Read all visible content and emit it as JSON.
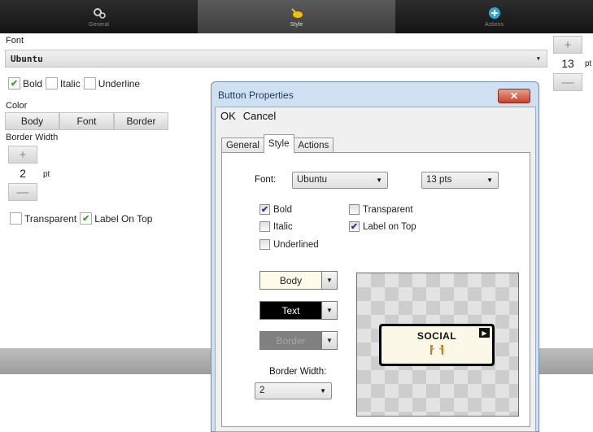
{
  "top_tabs": [
    {
      "label": "General",
      "icon": "gear-icon"
    },
    {
      "label": "Style",
      "icon": "style-icon"
    },
    {
      "label": "Actions",
      "icon": "plus-circle-icon"
    }
  ],
  "bg": {
    "font_label": "Font",
    "font_value": "Ubuntu",
    "font_size": "13",
    "font_size_unit": "pt",
    "bold": "Bold",
    "italic": "Italic",
    "underline": "Underline",
    "color_label": "Color",
    "color_buttons": [
      "Body",
      "Font",
      "Border"
    ],
    "border_width_label": "Border Width",
    "border_width_value": "2",
    "border_width_unit": "pt",
    "transparent": "Transparent",
    "label_on_top": "Label On Top",
    "plus": "+",
    "minus": "—"
  },
  "dialog": {
    "title": "Button Properties",
    "close": "✕",
    "menu": [
      "OK",
      "Cancel"
    ],
    "tabs": [
      "General",
      "Style",
      "Actions"
    ],
    "font_label": "Font:",
    "font_value": "Ubuntu",
    "size_value": "13 pts",
    "bold": "Bold",
    "italic": "Italic",
    "underlined": "Underlined",
    "transparent": "Transparent",
    "label_on_top": "Label on Top",
    "body": "Body",
    "text": "Text",
    "border": "Border",
    "border_width_label": "Border Width:",
    "border_width_value": "2",
    "preview_label": "SOCIAL"
  },
  "colors": {
    "accent_green": "#3aa03a",
    "close_red": "#c7432b",
    "text_swatch": "#000000",
    "border_swatch": "#808080",
    "body_swatch": "#fffbea"
  }
}
